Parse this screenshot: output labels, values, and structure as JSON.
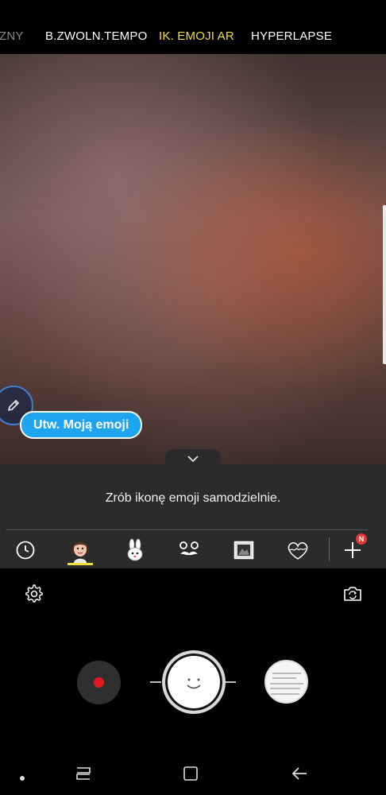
{
  "modes": {
    "items": [
      {
        "label": "ZNY",
        "state": "faded"
      },
      {
        "label": "B.ZWOLN.TEMPO",
        "state": "normal"
      },
      {
        "label": "IK. EMOJI AR",
        "state": "active"
      },
      {
        "label": "HYPERLAPSE",
        "state": "normal"
      }
    ],
    "active_color": "#f2dd3c"
  },
  "preview": {
    "create_emoji_label": "Utw. Moją emoji",
    "edit_icon": "pencil-icon"
  },
  "panel": {
    "message": "Zrób ikonę emoji samodzielnie.",
    "collapse_icon": "chevron-down-icon",
    "tray": [
      {
        "name": "recent",
        "icon": "clock-icon"
      },
      {
        "name": "my-emoji",
        "icon": "avatar-emoji-icon",
        "selected": true
      },
      {
        "name": "bunny",
        "icon": "bunny-sticker-icon"
      },
      {
        "name": "mustache",
        "icon": "mustache-sticker-icon"
      },
      {
        "name": "frame",
        "icon": "frame-sticker-icon"
      },
      {
        "name": "darling",
        "icon": "darling-heart-sticker-icon"
      },
      {
        "name": "add",
        "icon": "plus-icon",
        "badge": "N"
      }
    ]
  },
  "controls": {
    "settings_icon": "gear-icon",
    "flip_icon": "switch-camera-icon",
    "record_icon": "record-icon",
    "shutter_icon": "smiley-shutter-icon",
    "gallery_icon": "gallery-thumbnail"
  },
  "nav": {
    "items": [
      "dot-icon",
      "recent-apps-icon",
      "home-icon",
      "back-icon"
    ]
  }
}
